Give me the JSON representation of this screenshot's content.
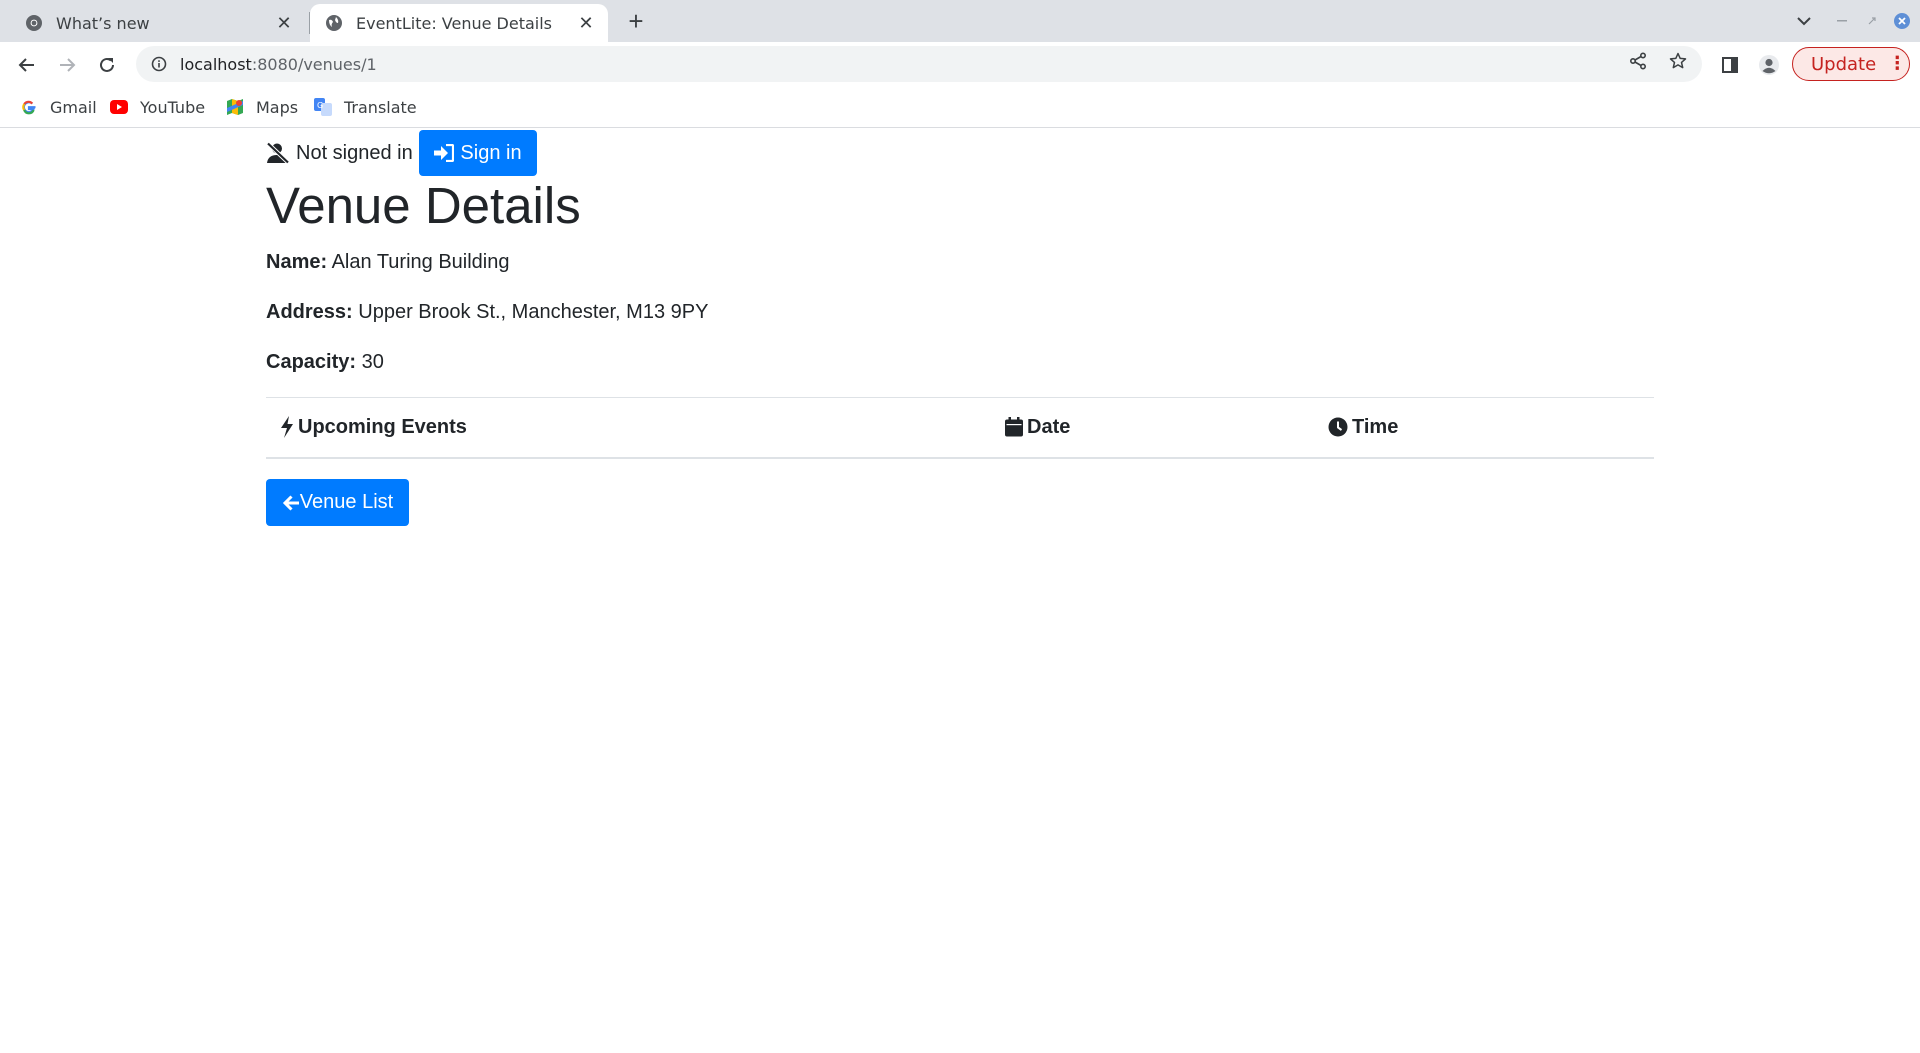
{
  "browser": {
    "tabs": [
      {
        "title": "What’s new",
        "active": false
      },
      {
        "title": "EventLite: Venue Details",
        "active": true
      }
    ],
    "url_host": "localhost",
    "url_path": ":8080/venues/1",
    "update_label": "Update",
    "bookmarks": [
      {
        "label": "Gmail",
        "icon": "google-icon"
      },
      {
        "label": "YouTube",
        "icon": "youtube-icon"
      },
      {
        "label": "Maps",
        "icon": "maps-icon"
      },
      {
        "label": "Translate",
        "icon": "translate-icon"
      }
    ]
  },
  "auth": {
    "status_text": "Not signed in",
    "sign_in_label": "Sign in"
  },
  "venue": {
    "heading": "Venue Details",
    "name_label": "Name:",
    "name_value": "Alan Turing Building",
    "address_label": "Address:",
    "address_value": "Upper Brook St., Manchester, M13 9PY",
    "capacity_label": "Capacity:",
    "capacity_value": "30"
  },
  "events_table": {
    "columns": [
      {
        "label": "Upcoming Events",
        "icon": "bolt-icon"
      },
      {
        "label": "Date",
        "icon": "calendar-icon"
      },
      {
        "label": "Time",
        "icon": "clock-icon"
      }
    ]
  },
  "venue_list_button": "Venue List",
  "colors": {
    "primary": "#007bff",
    "update": "#c5221f",
    "text": "#212529"
  }
}
